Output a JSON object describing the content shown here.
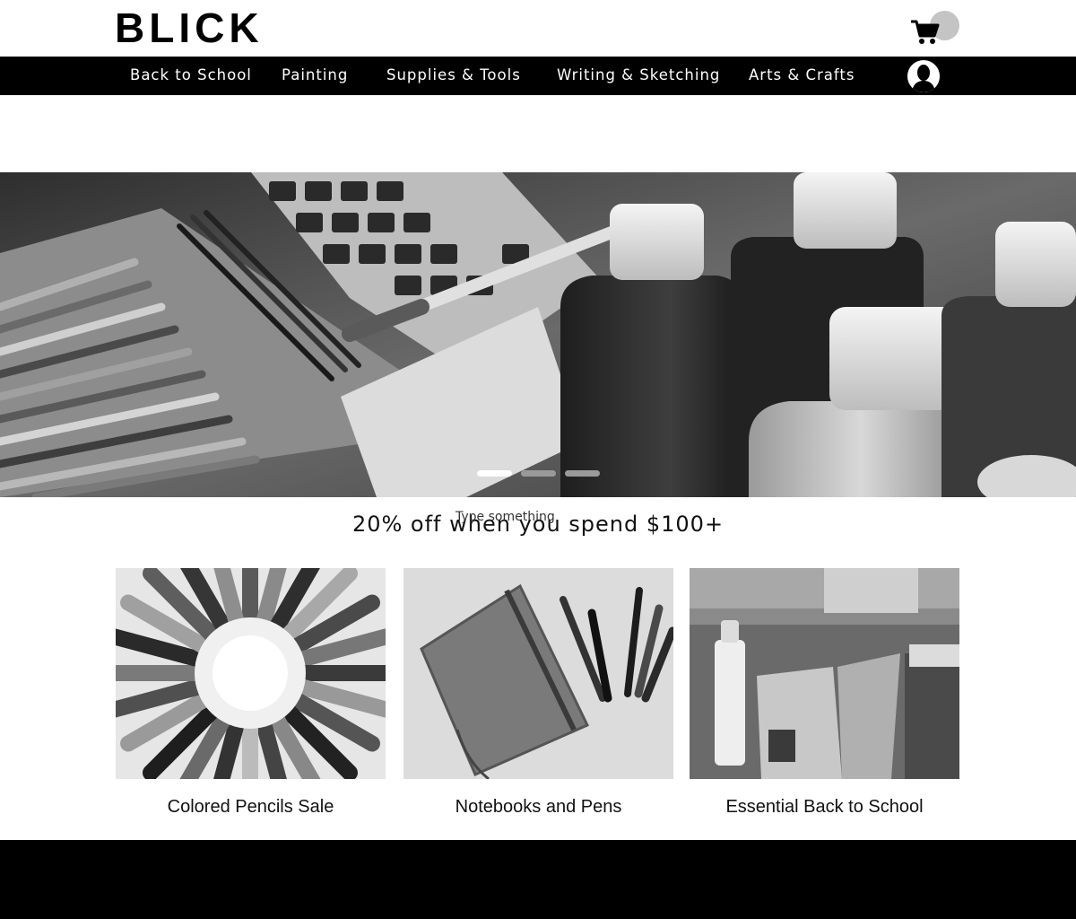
{
  "brand": {
    "logo_text": "BLICK"
  },
  "header": {
    "cart_icon": "cart-icon",
    "cart_badge_color": "#c4c4c4"
  },
  "nav": {
    "items": [
      {
        "label": "Back to School"
      },
      {
        "label": "Painting"
      },
      {
        "label": "Supplies & Tools"
      },
      {
        "label": "Writing & Sketching"
      },
      {
        "label": "Arts & Crafts"
      }
    ],
    "account_icon": "user-avatar-icon"
  },
  "hero": {
    "image": "art-supplies-photo",
    "slides_total": 3,
    "active_slide": 1
  },
  "promo": {
    "text": "20% off when you spend $100+",
    "placeholder": "Type something"
  },
  "cards": [
    {
      "caption": "Colored Pencils Sale",
      "image": "colored-pencils-photo"
    },
    {
      "caption": "Notebooks and Pens",
      "image": "notebook-pens-photo"
    },
    {
      "caption": "Essential Back to School",
      "image": "crayons-glue-photo"
    }
  ],
  "colors": {
    "nav_background": "#000000",
    "nav_text": "#ffffff",
    "footer_background": "#000000"
  }
}
